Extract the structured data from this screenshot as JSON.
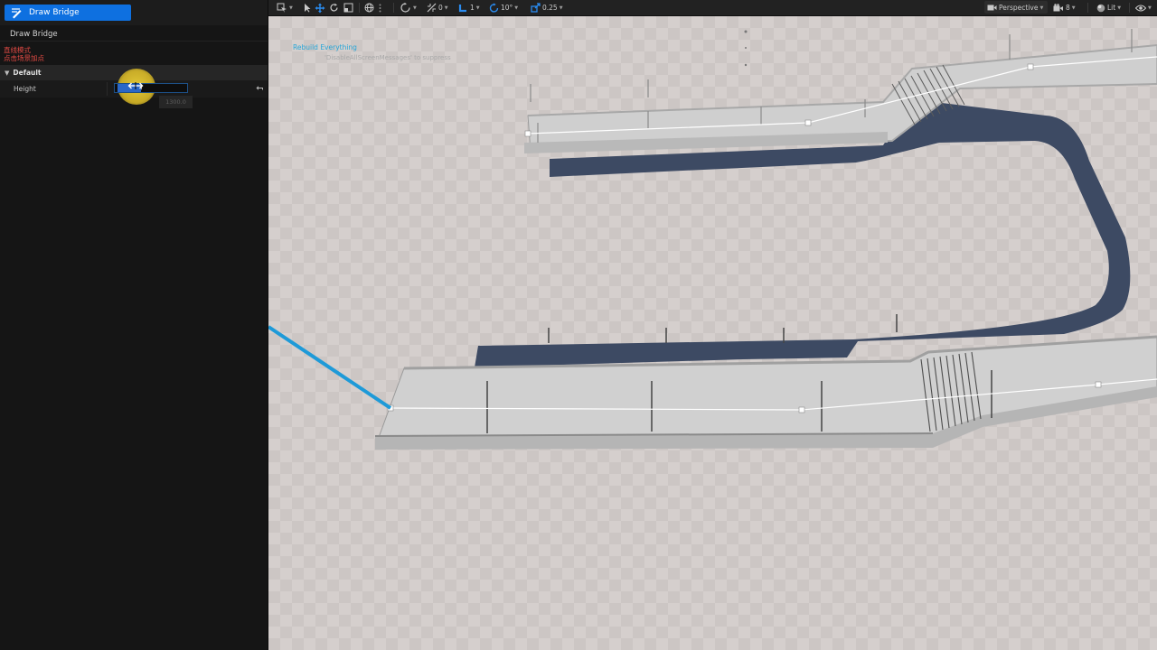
{
  "tool": {
    "label": "Draw Bridge",
    "icon": "draw-bridge-icon",
    "accent": "#0e70e0"
  },
  "panel": {
    "title": "Draw Bridge",
    "hint_line1": "直线模式",
    "hint_line2": "点击场景加点",
    "hint_color": "#e24a44",
    "category": "Default",
    "property": {
      "label": "Height",
      "value": "1300.0",
      "tooltip": "1300.0"
    }
  },
  "toolbar": {
    "translate_snap": "0",
    "layer": "1",
    "rotate_snap": "10°",
    "scale_snap": "0.25",
    "view_mode": "Perspective",
    "camera_speed": "8",
    "lighting": "Lit"
  },
  "viewport": {
    "message_title": "Rebuild Everything",
    "message_hint": "'DisableAllScreenMessages' to suppress",
    "message_color": "#27a6d8",
    "spline_color": "#1e9ad8"
  }
}
